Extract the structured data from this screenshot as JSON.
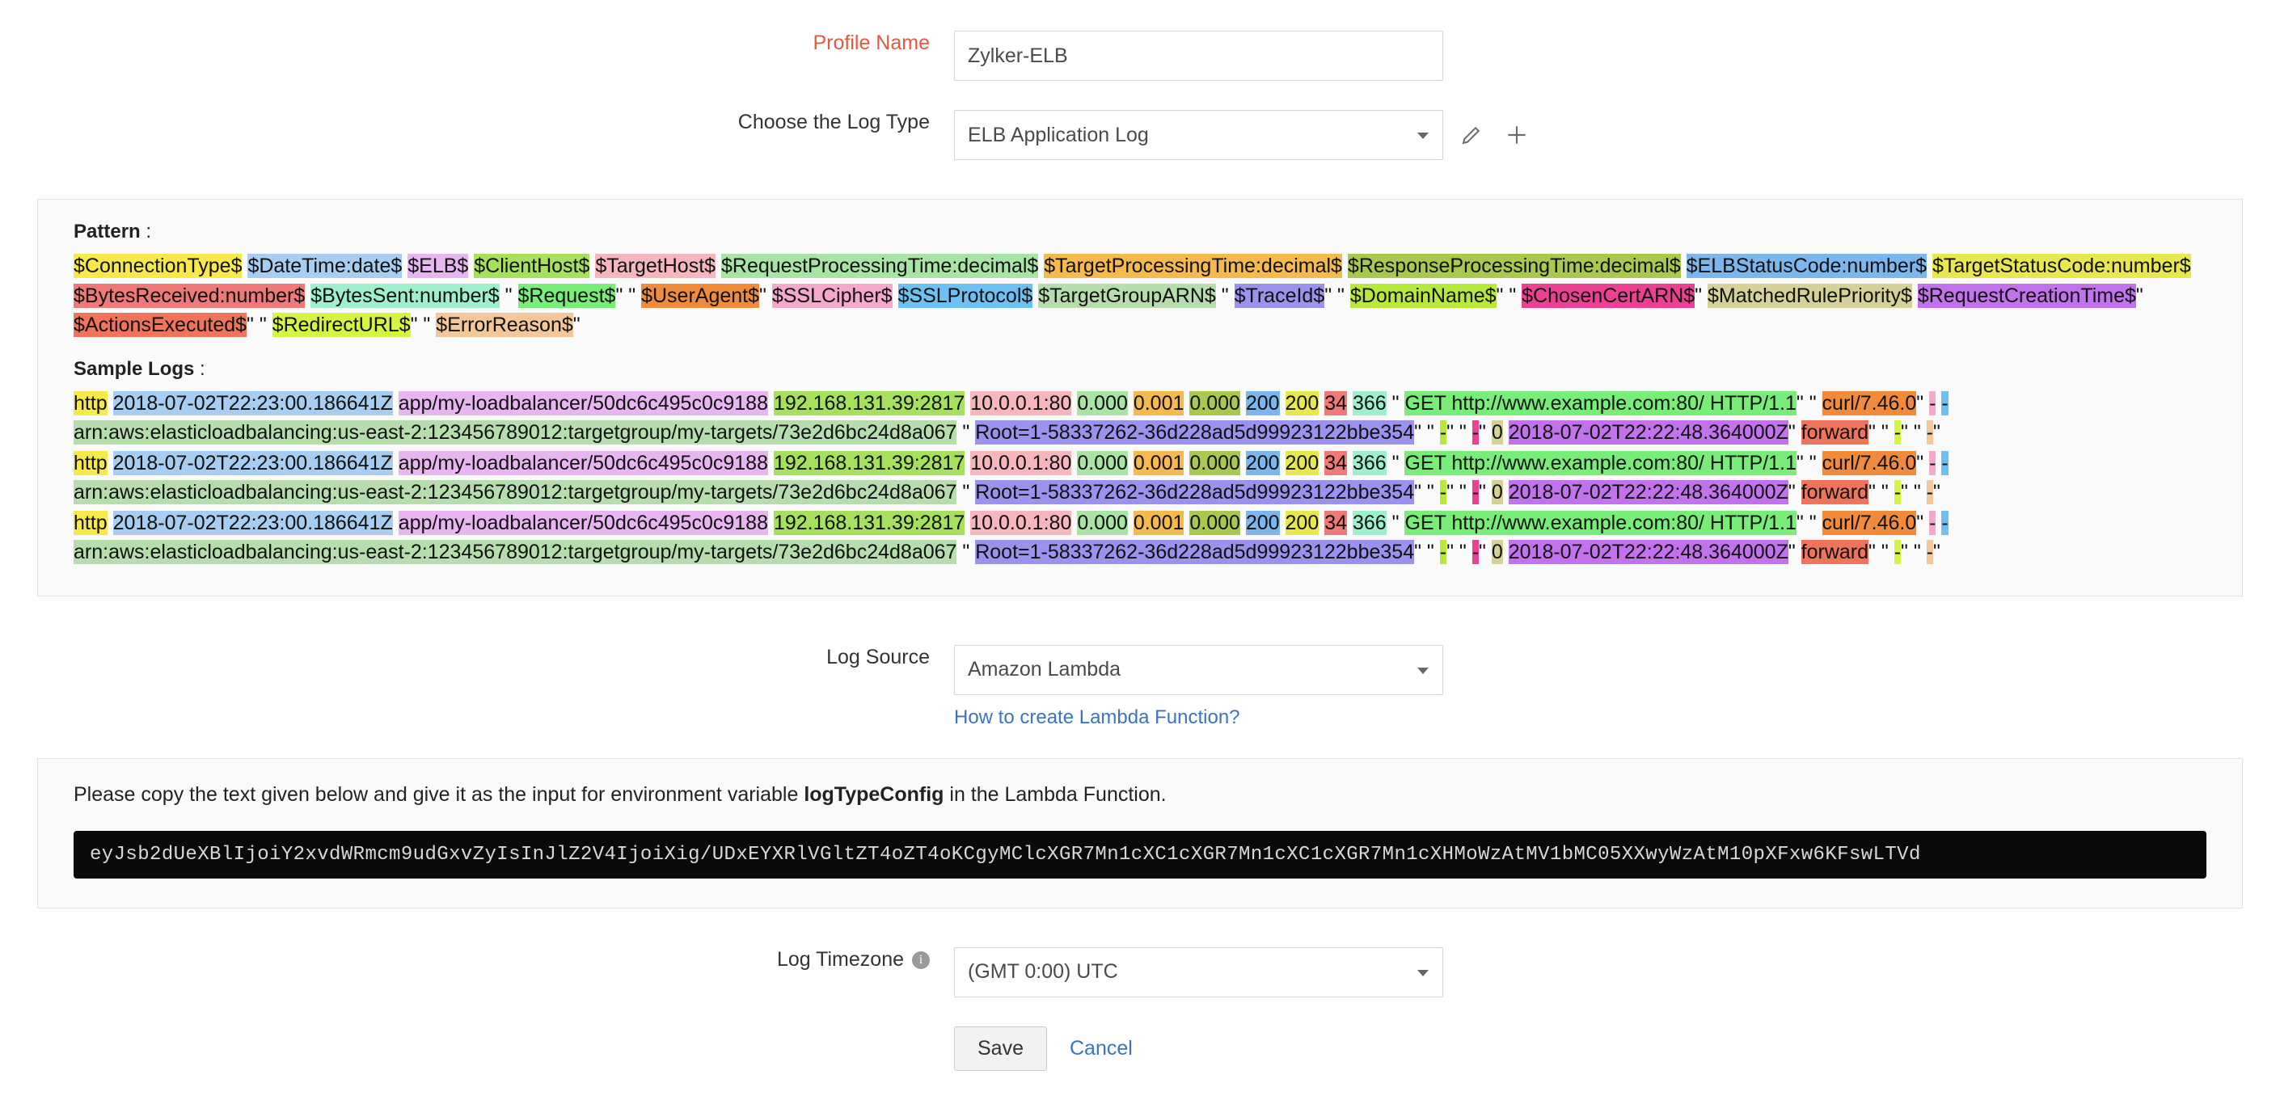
{
  "form": {
    "profile_name": {
      "label": "Profile Name",
      "value": "Zylker-ELB",
      "placeholder": "Profile Name"
    },
    "log_type": {
      "label": "Choose the Log Type",
      "value": "ELB Application Log",
      "edit_icon": "pencil-icon",
      "add_icon": "plus-icon"
    },
    "log_source": {
      "label": "Log Source",
      "value": "Amazon Lambda",
      "help_link": "How to create Lambda Function?"
    },
    "log_timezone": {
      "label": "Log Timezone",
      "value": "(GMT 0:00) UTC",
      "info_icon": "info-icon"
    }
  },
  "pattern_panel": {
    "pattern_heading_bold": "Pattern",
    "pattern_heading_rest": " :",
    "sample_heading_bold": "Sample Logs",
    "sample_heading_rest": " :",
    "pattern_tokens": [
      {
        "t": "$ConnectionType$",
        "bg": "#f7e94a"
      },
      {
        "t": " ",
        "bg": ""
      },
      {
        "t": "$DateTime:date$",
        "bg": "#a8cdf0"
      },
      {
        "t": " ",
        "bg": ""
      },
      {
        "t": "$ELB$",
        "bg": "#e7b6f0"
      },
      {
        "t": " ",
        "bg": ""
      },
      {
        "t": "$ClientHost$",
        "bg": "#a7e05c"
      },
      {
        "t": " ",
        "bg": ""
      },
      {
        "t": "$TargetHost$",
        "bg": "#f5b6bd"
      },
      {
        "t": " ",
        "bg": ""
      },
      {
        "t": "$RequestProcessingTime:decimal$",
        "bg": "#a9e3a6"
      },
      {
        "t": " ",
        "bg": ""
      },
      {
        "t": "$TargetProcessingTime:decimal$",
        "bg": "#f5ba4e"
      },
      {
        "t": " ",
        "bg": ""
      },
      {
        "t": "$ResponseProcessingTime:decimal$",
        "bg": "#a9c84e"
      },
      {
        "t": " ",
        "bg": ""
      },
      {
        "t": "$ELBStatusCode:number$",
        "bg": "#7cb6ec"
      },
      {
        "t": " ",
        "bg": ""
      },
      {
        "t": "$TargetStatusCode:number$",
        "bg": "#e8e84e"
      },
      {
        "t": " ",
        "bg": ""
      },
      {
        "t": "$BytesReceived:number$",
        "bg": "#ef7878"
      },
      {
        "t": " ",
        "bg": ""
      },
      {
        "t": "$BytesSent:number$",
        "bg": "#9ef0cd"
      },
      {
        "t": " \" ",
        "bg": ""
      },
      {
        "t": "$Request$",
        "bg": "#78ed78"
      },
      {
        "t": "\" \" ",
        "bg": ""
      },
      {
        "t": "$UserAgent$",
        "bg": "#f08b3c"
      },
      {
        "t": "\" ",
        "bg": ""
      },
      {
        "t": "$SSLCipher$",
        "bg": "#f4a8cc"
      },
      {
        "t": " ",
        "bg": ""
      },
      {
        "t": "$SSLProtocol$",
        "bg": "#6cc0f2"
      },
      {
        "t": " ",
        "bg": ""
      },
      {
        "t": "$TargetGroupARN$",
        "bg": "#b7dcae"
      },
      {
        "t": " \" ",
        "bg": ""
      },
      {
        "t": "$TraceId$",
        "bg": "#9a92ec"
      },
      {
        "t": "\" \" ",
        "bg": ""
      },
      {
        "t": "$DomainName$",
        "bg": "#b8e83c"
      },
      {
        "t": "\" \" ",
        "bg": ""
      },
      {
        "t": "$ChosenCertARN$",
        "bg": "#ec4192"
      },
      {
        "t": "\" ",
        "bg": ""
      },
      {
        "t": "$MatchedRulePriority$",
        "bg": "#d6d199"
      },
      {
        "t": " ",
        "bg": ""
      },
      {
        "t": "$RequestCreationTime$",
        "bg": "#c172ec"
      },
      {
        "t": "\" ",
        "bg": ""
      },
      {
        "t": "$ActionsExecuted$",
        "bg": "#f0735c"
      },
      {
        "t": "\" \" ",
        "bg": ""
      },
      {
        "t": "$RedirectURL$",
        "bg": "#d5f542"
      },
      {
        "t": "\" \" ",
        "bg": ""
      },
      {
        "t": "$ErrorReason$",
        "bg": "#f4c79a"
      },
      {
        "t": "\"",
        "bg": ""
      }
    ],
    "sample_log_tokens": [
      {
        "t": "http",
        "bg": "#f7e94a"
      },
      {
        "t": " ",
        "bg": ""
      },
      {
        "t": "2018-07-02T22:23:00.186641Z",
        "bg": "#a8cdf0"
      },
      {
        "t": " ",
        "bg": ""
      },
      {
        "t": "app/my-loadbalancer/50dc6c495c0c9188",
        "bg": "#e7b6f0"
      },
      {
        "t": " ",
        "bg": ""
      },
      {
        "t": "192.168.131.39:2817",
        "bg": "#a7e05c"
      },
      {
        "t": " ",
        "bg": ""
      },
      {
        "t": "10.0.0.1:80",
        "bg": "#f5b6bd"
      },
      {
        "t": " ",
        "bg": ""
      },
      {
        "t": "0.000",
        "bg": "#a9e3a6"
      },
      {
        "t": " ",
        "bg": ""
      },
      {
        "t": "0.001",
        "bg": "#f5ba4e"
      },
      {
        "t": " ",
        "bg": ""
      },
      {
        "t": "0.000",
        "bg": "#a9c84e"
      },
      {
        "t": " ",
        "bg": ""
      },
      {
        "t": "200",
        "bg": "#7cb6ec"
      },
      {
        "t": " ",
        "bg": ""
      },
      {
        "t": "200",
        "bg": "#e8e84e"
      },
      {
        "t": " ",
        "bg": ""
      },
      {
        "t": "34",
        "bg": "#ef7878"
      },
      {
        "t": " ",
        "bg": ""
      },
      {
        "t": "366",
        "bg": "#9ef0cd"
      },
      {
        "t": " \" ",
        "bg": ""
      },
      {
        "t": "GET http://www.example.com:80/ HTTP/1.1",
        "bg": "#78ed78"
      },
      {
        "t": "\" \" ",
        "bg": ""
      },
      {
        "t": "curl/7.46.0",
        "bg": "#f08b3c"
      },
      {
        "t": "\" ",
        "bg": ""
      },
      {
        "t": "-",
        "bg": "#f4a8cc"
      },
      {
        "t": " ",
        "bg": ""
      },
      {
        "t": "-",
        "bg": "#6cc0f2"
      },
      {
        "t": " ",
        "bg": ""
      },
      {
        "t": "arn:aws:elasticloadbalancing:us-east-2:123456789012:targetgroup/my-targets/73e2d6bc24d8a067",
        "bg": "#b7dcae"
      },
      {
        "t": " \" ",
        "bg": ""
      },
      {
        "t": "Root=1-58337262-36d228ad5d99923122bbe354",
        "bg": "#9a92ec"
      },
      {
        "t": "\" \" ",
        "bg": ""
      },
      {
        "t": "-",
        "bg": "#b8e83c"
      },
      {
        "t": "\" \" ",
        "bg": ""
      },
      {
        "t": "-",
        "bg": "#ec4192"
      },
      {
        "t": "\" ",
        "bg": ""
      },
      {
        "t": "0",
        "bg": "#d6d199"
      },
      {
        "t": " ",
        "bg": ""
      },
      {
        "t": "2018-07-02T22:22:48.364000Z",
        "bg": "#c172ec"
      },
      {
        "t": "\" ",
        "bg": ""
      },
      {
        "t": "forward",
        "bg": "#f0735c"
      },
      {
        "t": "\" \" ",
        "bg": ""
      },
      {
        "t": "-",
        "bg": "#d5f542"
      },
      {
        "t": "\" \" ",
        "bg": ""
      },
      {
        "t": "-",
        "bg": "#f4c79a"
      },
      {
        "t": "\"",
        "bg": ""
      }
    ],
    "sample_log_count": 3
  },
  "lambda_panel": {
    "note_prefix": "Please copy the text given below and give it as the input for environment variable ",
    "note_bold": "logTypeConfig",
    "note_suffix": " in the Lambda Function.",
    "token": "eyJsb2dUeXBlIjoiY2xvdWRmcm9udGxvZyIsInJlZ2V4IjoiXig/UDxEYXRlVGltZT4oZT4oKCgyMClcXGR7Mn1cXC1cXGR7Mn1cXC1cXGR7Mn1cXHMoWzAtMV1bMC05XXwyWzAtM10pXFxw6KFswLTVd"
  },
  "footer": {
    "save_label": "Save",
    "cancel_label": "Cancel"
  }
}
